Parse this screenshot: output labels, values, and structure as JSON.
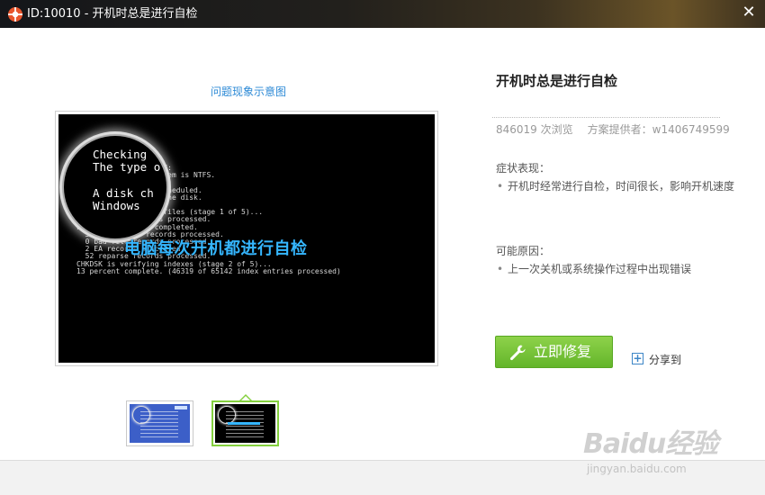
{
  "window": {
    "title": "ID:10010 - 开机时总是进行自检",
    "close_symbol": "✕"
  },
  "preview": {
    "caption": "问题现象示意图",
    "magnifier_text": "Checking\nThe type o\n\nA disk ch\nWindows",
    "console_text": "              em on C:\n              le system is NTFS.\n\n              been scheduled.\n              check the disk.\n\nCHKDSK is verifying files (stage 1 of 5)...\n  44800 file records processed.\nFile verification completed.\n  32 large file records processed.\n  0 bad file records processed.\n  2 EA records processed.\n  52 reparse records processed.\nCHKDSK is verifying indexes (stage 2 of 5)...\n13 percent complete. (46319 of 65142 index entries processed)",
    "overlay_text": "电脑每次开机都进行自检"
  },
  "thumbnails": [
    {
      "name": "thumbnail-1",
      "active": false
    },
    {
      "name": "thumbnail-2",
      "active": true
    }
  ],
  "detail": {
    "title": "开机时总是进行自检",
    "views": "846019 次浏览",
    "provider": "方案提供者：w1406749599",
    "symptom_label": "症状表现：",
    "symptom_item": "开机时经常进行自检，时间很长，影响开机速度",
    "cause_label": "可能原因：",
    "cause_item": "上一次关机或系统操作过程中出现错误",
    "bullet": "•"
  },
  "actions": {
    "repair_label": "立即修复",
    "share_label": "分享到",
    "share_symbol": "+"
  },
  "watermark": {
    "logo": "Baidu经验",
    "url": "jingyan.baidu.com"
  },
  "colors": {
    "accent_green": "#6cbd31",
    "link_blue": "#2d8ad6",
    "overlay_blue": "#35b6ff"
  }
}
